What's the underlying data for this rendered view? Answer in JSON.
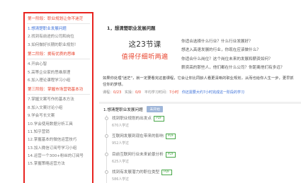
{
  "sidebar": {
    "phases": [
      {
        "title": "第一阶段：职业规划让你不迷茫",
        "lessons": [
          "1.想清楚职业发展问题",
          "2.找到有前途的公司和岗位",
          "3.如何做好长期的职业规划！"
        ],
        "active_index": 0
      },
      {
        "title": "第二阶段：拥有优质的思维",
        "lessons": [
          "4.开启心智",
          "5.高等企业家的思维原理",
          "6.加入理论课程学习小组"
        ],
        "active_index": -1
      },
      {
        "title": "第三阶段：掌握市场营销基本功",
        "lessons": [
          "7.掌握文案写作的基本方法",
          "8.加入文案讨论小组",
          "9.学会写长文案",
          "10.学会使用数据分析工具",
          "11.知乎营销",
          "12.掌握基本的微信运营技巧",
          "13.加入微信订阅号学习小组",
          "14.运营一个300+粉丝的订阅号",
          "15.掌握策略运营方法"
        ],
        "active_index": -1
      }
    ]
  },
  "main": {
    "section_title": "1，想清楚职业发展问题",
    "hero": {
      "count_text": "这23节课",
      "tagline": "值得仔细听两遍",
      "questions": [
        "你适合选择什么行业？什么行业发展好？",
        "想进入高速发展的行业，你现在应该做什么？",
        "你适合什么岗位？这个岗位未来的发展和薪资如何？",
        "薪资高的那些人，他们都在什么公司？你距离他们有多远？"
      ]
    },
    "description": "如果你处理\"迷茫\"，就一定要看完这套课程，它会让你比同龄人看更清晰的职业规划，从而也给你人生一步，更早抓住你的梦想。",
    "meta": {
      "lessons_label": "课程：",
      "lessons_value": "0/23",
      "practice_label": "实操：",
      "practice_value": "0/0",
      "study_label": "平均学习时间：",
      "study_value": "7小时",
      "tip": "你还需要大约7小时完成这一阶段的学习"
    },
    "chapter": {
      "title": "1.想清楚职业发展问题",
      "badge": "未开始",
      "items": [
        {
          "title": "找到职业规划的出发点",
          "tag": "PDF",
          "sub": "670人学过"
        },
        {
          "title": "互联网发展到现在带来的影响",
          "tag": "PDF",
          "sub": "952人学过"
        },
        {
          "title": "目前互联网行业未来前景分析",
          "tag": "PDF",
          "sub": "625人学过"
        },
        {
          "title": "找到有发展潜力的职位类型",
          "tag": "PDF",
          "sub": "586人学过"
        }
      ]
    }
  }
}
